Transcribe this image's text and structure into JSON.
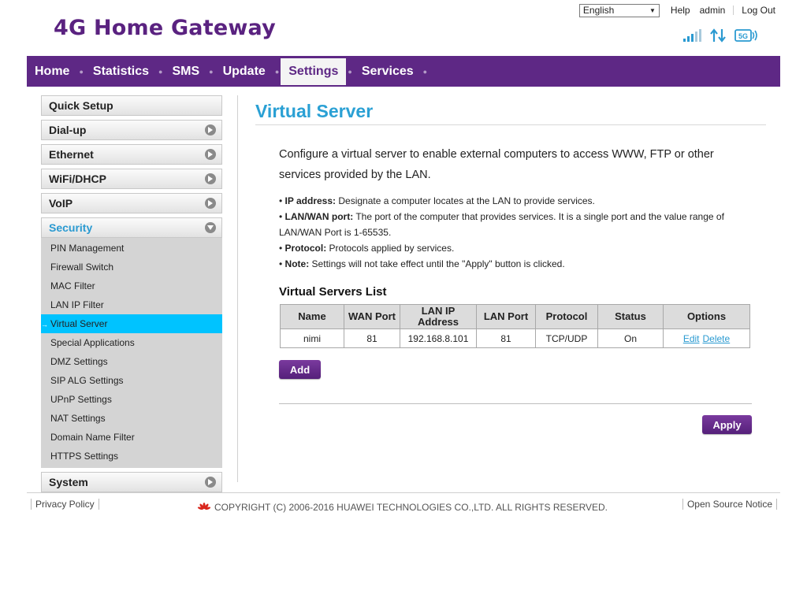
{
  "brand": "4G Home Gateway",
  "top": {
    "language": "English",
    "help": "Help",
    "user": "admin",
    "logout": "Log Out"
  },
  "nav": [
    "Home",
    "Statistics",
    "SMS",
    "Update",
    "Settings",
    "Services"
  ],
  "nav_active": "Settings",
  "sidebar": {
    "quick_setup": "Quick Setup",
    "dialup": "Dial-up",
    "ethernet": "Ethernet",
    "wifi": "WiFi/DHCP",
    "voip": "VoIP",
    "security": "Security",
    "security_items": [
      "PIN Management",
      "Firewall Switch",
      "MAC Filter",
      "LAN IP Filter",
      "Virtual Server",
      "Special Applications",
      "DMZ Settings",
      "SIP ALG Settings",
      "UPnP Settings",
      "NAT Settings",
      "Domain Name Filter",
      "HTTPS Settings"
    ],
    "system": "System"
  },
  "main": {
    "title": "Virtual Server",
    "intro": "Configure a virtual server to enable external computers to access WWW, FTP or other services provided by the LAN.",
    "notes": [
      {
        "label": "IP address:",
        "text": " Designate a computer locates at the LAN to provide services."
      },
      {
        "label": "LAN/WAN port:",
        "text": " The port of the computer that provides services. It is a single port and the value range of LAN/WAN Port is 1-65535."
      },
      {
        "label": "Protocol:",
        "text": " Protocols applied by services."
      },
      {
        "label": "Note:",
        "text": " Settings will not take effect until the \"Apply\" button is clicked."
      }
    ],
    "list_title": "Virtual Servers List",
    "table": {
      "headers": [
        "Name",
        "WAN Port",
        "LAN IP Address",
        "LAN Port",
        "Protocol",
        "Status",
        "Options"
      ],
      "rows": [
        {
          "name": "nimi",
          "wan_port": "81",
          "lan_ip": "192.168.8.101",
          "lan_port": "81",
          "protocol": "TCP/UDP",
          "status": "On",
          "edit": "Edit",
          "delete": "Delete"
        }
      ]
    },
    "add_label": "Add",
    "apply_label": "Apply"
  },
  "footer": {
    "privacy": "Privacy Policy",
    "copyright": "COPYRIGHT (C) 2006-2016 HUAWEI TECHNOLOGIES CO.,LTD. ALL RIGHTS RESERVED.",
    "open_source": "Open Source Notice"
  },
  "colors": {
    "brand_purple": "#5e2885",
    "accent_blue": "#2aa0d4",
    "active_item": "#00c3ff"
  }
}
